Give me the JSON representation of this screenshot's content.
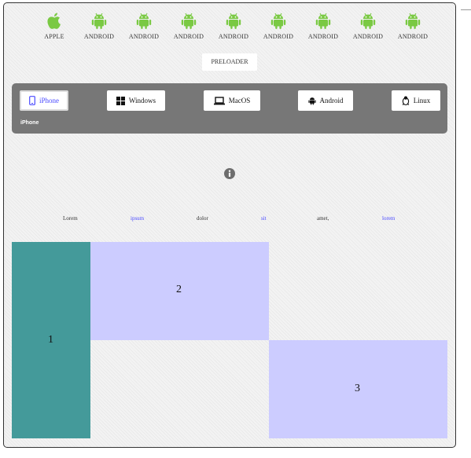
{
  "os_icons": [
    {
      "label": "APPLE",
      "icon": "apple-icon",
      "color": "#7ac943"
    },
    {
      "label": "ANDROID",
      "icon": "android-icon",
      "color": "#7ac943"
    },
    {
      "label": "ANDROID",
      "icon": "android-icon",
      "color": "#7ac943"
    },
    {
      "label": "ANDROID",
      "icon": "android-icon",
      "color": "#7ac943"
    },
    {
      "label": "ANDROID",
      "icon": "android-icon",
      "color": "#7ac943"
    },
    {
      "label": "ANDROID",
      "icon": "android-icon",
      "color": "#7ac943"
    },
    {
      "label": "ANDROID",
      "icon": "android-icon",
      "color": "#7ac943"
    },
    {
      "label": "ANDROID",
      "icon": "android-icon",
      "color": "#7ac943"
    },
    {
      "label": "ANDROID",
      "icon": "android-icon",
      "color": "#7ac943"
    }
  ],
  "preloader_label": "PRELOADER",
  "tabs": [
    {
      "label": "iPhone",
      "icon": "mobile-icon",
      "active": true
    },
    {
      "label": "Windows",
      "icon": "windows-icon",
      "active": false
    },
    {
      "label": "MacOS",
      "icon": "laptop-icon",
      "active": false
    },
    {
      "label": "Android",
      "icon": "android-icon",
      "active": false
    },
    {
      "label": "Linux",
      "icon": "linux-icon",
      "active": false
    }
  ],
  "active_tab_content": "iPhone",
  "info_icon": "info-icon",
  "words": [
    {
      "text": "Lorem",
      "color": "#333333"
    },
    {
      "text": "ipsum",
      "color": "#4a4aff"
    },
    {
      "text": "dolor",
      "color": "#333333"
    },
    {
      "text": "sit",
      "color": "#4a4aff"
    },
    {
      "text": "amet,",
      "color": "#333333"
    },
    {
      "text": "lorem",
      "color": "#4a4aff"
    }
  ],
  "blocks": [
    {
      "label": "1",
      "color": "#449a9a"
    },
    {
      "label": "2",
      "color": "#ccccff"
    },
    {
      "label": "3",
      "color": "#ccccff"
    }
  ]
}
